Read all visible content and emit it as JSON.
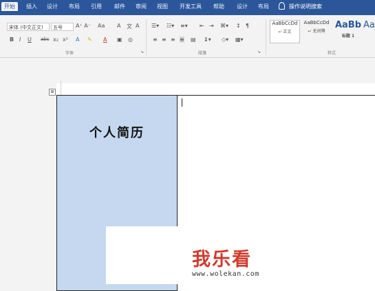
{
  "ribbon_tabs": [
    "开始",
    "插入",
    "设计",
    "布局",
    "引用",
    "邮件",
    "审阅",
    "视图",
    "开发工具",
    "帮助",
    "设计",
    "布局"
  ],
  "search_hint": "操作说明搜索",
  "font": {
    "name": "宋体 (中文正文)",
    "size": "五号"
  },
  "font_buttons": [
    "B",
    "I",
    "U",
    "abc",
    "x₂",
    "x²",
    "A",
    "A"
  ],
  "groups": {
    "font": "字体",
    "paragraph": "段落",
    "styles": "样式"
  },
  "styles": [
    {
      "preview": "AaBbCcDd",
      "name": "正文"
    },
    {
      "preview": "AaBbCcDd",
      "name": "无间隔"
    },
    {
      "preview": "AaBb",
      "name": "标题 1"
    },
    {
      "preview": "Aa"
    }
  ],
  "table_handle": "⊞",
  "document": {
    "cell_title": "个人简历"
  },
  "watermark": {
    "logo": "我乐看",
    "url": "www.wolekan.com"
  },
  "colors": {
    "ribbon_blue": "#2b579a",
    "cell_fill": "#c5d8ef"
  }
}
